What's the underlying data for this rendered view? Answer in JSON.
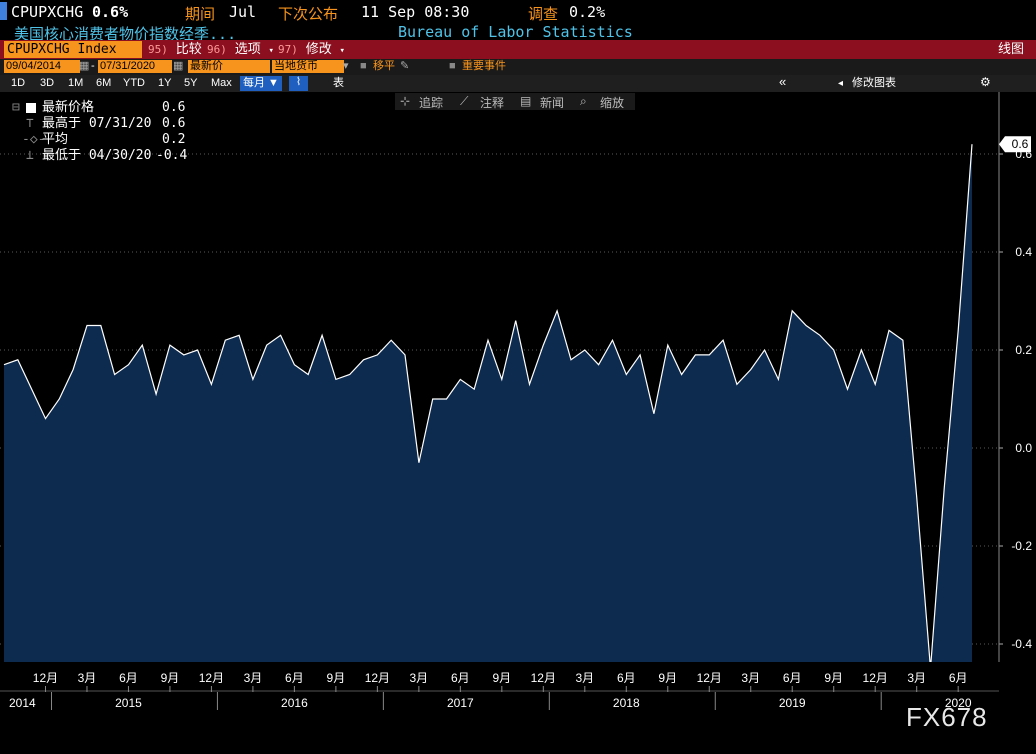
{
  "header": {
    "ticker": "CPUPXCHG",
    "last_value": "0.6%",
    "period_label": "期间",
    "period_value": "Jul",
    "next_release_label": "下次公布",
    "next_release_value": "11 Sep 08:30",
    "survey_label": "调查",
    "survey_value": "0.2%",
    "description": "美国核心消费者物价指数经季...",
    "source": "Bureau of Labor Statistics"
  },
  "toolbar": {
    "security": "CPUPXCHG Index",
    "compare_num": "95)",
    "compare_label": "比较",
    "options_num": "96)",
    "options_label": "选项",
    "edit_num": "97)",
    "edit_label": "修改",
    "chart_type": "线图"
  },
  "settings": {
    "start_date": "09/04/2014",
    "end_date": "07/31/2020",
    "price_field": "最新价",
    "currency": "当地货币",
    "shift_label": "移平",
    "events_label": "重要事件"
  },
  "ranges": {
    "buttons": [
      "1D",
      "3D",
      "1M",
      "6M",
      "YTD",
      "1Y",
      "5Y",
      "Max"
    ],
    "frequency": "每月 ▼",
    "table_label": "表",
    "collapse_icon": "«",
    "edit_chart_label": "修改图表",
    "settings_icon": "⚙"
  },
  "chart_tools": {
    "track": "追踪",
    "annotate": "注释",
    "news": "新闻",
    "zoom": "缩放"
  },
  "legend": {
    "last_label": "最新价格",
    "last_value": "0.6",
    "high_label": "最高于 07/31/20",
    "high_value": "0.6",
    "avg_label": "平均",
    "avg_value": "0.2",
    "low_label": "最低于 04/30/20",
    "low_value": "-0.4"
  },
  "watermark": "FX678",
  "colors": {
    "line": "#ffffff",
    "area_fill": "#0d2a4f",
    "grid": "#5a5a5a",
    "toolbar_red": "#8b0f1e",
    "field_orange": "#f7941d",
    "header_orange": "#f7941d",
    "source_blue": "#4fc3e8"
  },
  "chart_data": {
    "type": "area",
    "title": "",
    "xlabel": "",
    "ylabel": "",
    "ylim": [
      -0.5,
      0.7
    ],
    "yticks": [
      -0.4,
      -0.2,
      0.0,
      0.2,
      0.4,
      0.6
    ],
    "ytick_labels": [
      "-0.4",
      "-0.2",
      "0.0",
      "0.2",
      "0.4",
      "0.6"
    ],
    "last_label": "0.6",
    "x_month_labels": [
      "12月",
      "3月",
      "6月",
      "9月",
      "12月",
      "3月",
      "6月",
      "9月",
      "12月",
      "3月",
      "6月",
      "9月",
      "12月",
      "3月",
      "6月",
      "9月",
      "12月",
      "3月",
      "6月",
      "9月",
      "12月",
      "3月",
      "6月"
    ],
    "x_year_labels": [
      "2014",
      "2015",
      "2016",
      "2017",
      "2018",
      "2019",
      "2020"
    ],
    "start": "2014-09",
    "end": "2020-07",
    "values": [
      0.17,
      0.18,
      0.12,
      0.06,
      0.1,
      0.16,
      0.25,
      0.25,
      0.15,
      0.17,
      0.21,
      0.11,
      0.21,
      0.19,
      0.2,
      0.13,
      0.22,
      0.23,
      0.14,
      0.21,
      0.23,
      0.17,
      0.15,
      0.23,
      0.14,
      0.15,
      0.18,
      0.19,
      0.22,
      0.19,
      -0.03,
      0.1,
      0.1,
      0.14,
      0.12,
      0.22,
      0.14,
      0.26,
      0.13,
      0.21,
      0.28,
      0.18,
      0.2,
      0.17,
      0.22,
      0.15,
      0.19,
      0.07,
      0.21,
      0.15,
      0.19,
      0.19,
      0.22,
      0.13,
      0.16,
      0.2,
      0.14,
      0.28,
      0.25,
      0.23,
      0.2,
      0.12,
      0.2,
      0.13,
      0.24,
      0.22,
      -0.1,
      -0.45,
      -0.08,
      0.24,
      0.62
    ],
    "grid": true,
    "grid_style": "dotted horizontal",
    "legend_position": "top-left"
  }
}
